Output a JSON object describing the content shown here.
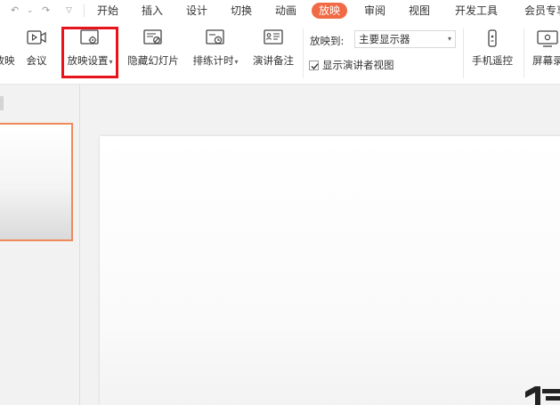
{
  "menu": {
    "tabs": [
      {
        "label": "开始",
        "active": false
      },
      {
        "label": "插入",
        "active": false
      },
      {
        "label": "设计",
        "active": false
      },
      {
        "label": "切换",
        "active": false
      },
      {
        "label": "动画",
        "active": false
      },
      {
        "label": "放映",
        "active": true
      },
      {
        "label": "审阅",
        "active": false
      },
      {
        "label": "视图",
        "active": false
      },
      {
        "label": "开发工具",
        "active": false
      },
      {
        "label": "会员专享",
        "active": false
      }
    ]
  },
  "ribbon": {
    "play_label": "放映",
    "meeting_label": "会议",
    "slideshow_settings_label": "放映设置",
    "hide_slide_label": "隐藏幻灯片",
    "rehearse_timing_label": "排练计时",
    "speaker_notes_label": "演讲备注",
    "show_to_label": "放映到:",
    "monitor_value": "主要显示器",
    "presenter_view_label": "显示演讲者视图",
    "presenter_view_checked": true,
    "phone_remote_label": "手机遥控",
    "screen_record_label": "屏幕录"
  },
  "colors": {
    "accent": "#f06a45",
    "highlight": "#e8141b",
    "thumb_border": "#ef8a5a"
  },
  "icons": {
    "undo": "undo-icon",
    "redo": "redo-icon",
    "meeting": "video-play-icon",
    "settings": "monitor-gear-icon",
    "hide": "slide-hide-icon",
    "timer": "slide-timer-icon",
    "notes": "notes-icon",
    "phone": "phone-remote-icon",
    "record": "screen-record-icon"
  }
}
